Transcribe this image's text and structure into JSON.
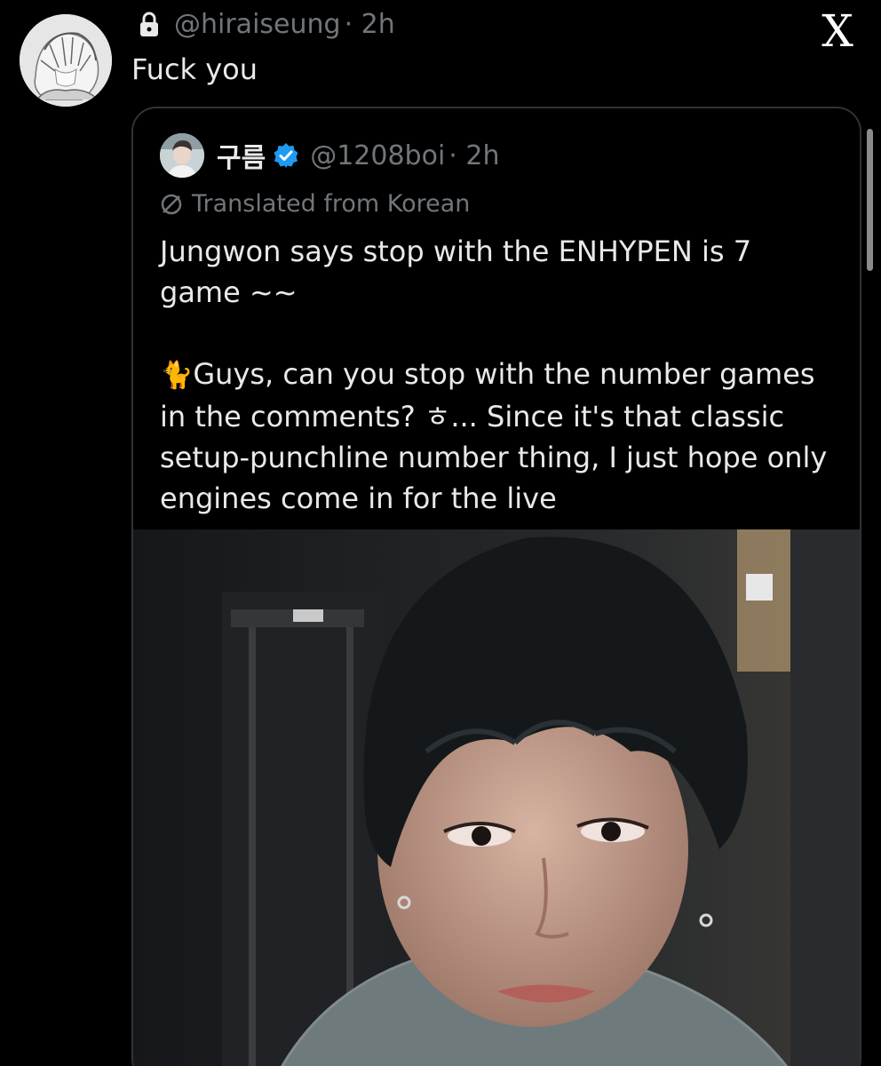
{
  "reply": {
    "handle": "@hiraiseung",
    "time": "· 2h",
    "text": "Fuck you",
    "lock_icon": "lock-icon",
    "avatar": "user-avatar"
  },
  "quote": {
    "display_name": "구름",
    "handle": "@1208boi",
    "time": "· 2h",
    "verified_color": "#1d9bf0",
    "translated_label": "Translated from Korean",
    "text_line1": "Jungwon says stop with the ENHYPEN is 7",
    "text_line2": "game ~~",
    "emoji": "🐈",
    "text_para2": "Guys, can you stop with the number games in the comments? ㅎ... Since it's that classic setup-punchline number thing, I just hope only engines come in for the live",
    "media": "video-still"
  },
  "app": {
    "logo": "X"
  },
  "colors": {
    "background": "#000000",
    "text": "#e7e9ea",
    "muted": "#71767b",
    "border": "#2f3336"
  }
}
